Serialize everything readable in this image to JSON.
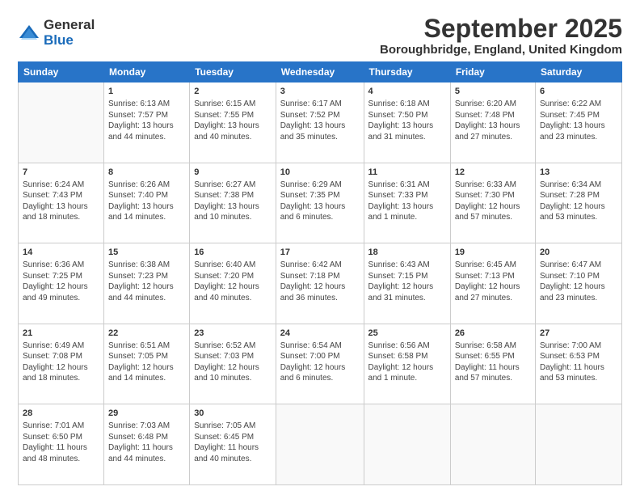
{
  "logo": {
    "general": "General",
    "blue": "Blue"
  },
  "title": "September 2025",
  "location": "Boroughbridge, England, United Kingdom",
  "weekdays": [
    "Sunday",
    "Monday",
    "Tuesday",
    "Wednesday",
    "Thursday",
    "Friday",
    "Saturday"
  ],
  "weeks": [
    [
      {
        "day": "",
        "content": ""
      },
      {
        "day": "1",
        "content": "Sunrise: 6:13 AM\nSunset: 7:57 PM\nDaylight: 13 hours and 44 minutes."
      },
      {
        "day": "2",
        "content": "Sunrise: 6:15 AM\nSunset: 7:55 PM\nDaylight: 13 hours and 40 minutes."
      },
      {
        "day": "3",
        "content": "Sunrise: 6:17 AM\nSunset: 7:52 PM\nDaylight: 13 hours and 35 minutes."
      },
      {
        "day": "4",
        "content": "Sunrise: 6:18 AM\nSunset: 7:50 PM\nDaylight: 13 hours and 31 minutes."
      },
      {
        "day": "5",
        "content": "Sunrise: 6:20 AM\nSunset: 7:48 PM\nDaylight: 13 hours and 27 minutes."
      },
      {
        "day": "6",
        "content": "Sunrise: 6:22 AM\nSunset: 7:45 PM\nDaylight: 13 hours and 23 minutes."
      }
    ],
    [
      {
        "day": "7",
        "content": "Sunrise: 6:24 AM\nSunset: 7:43 PM\nDaylight: 13 hours and 18 minutes."
      },
      {
        "day": "8",
        "content": "Sunrise: 6:26 AM\nSunset: 7:40 PM\nDaylight: 13 hours and 14 minutes."
      },
      {
        "day": "9",
        "content": "Sunrise: 6:27 AM\nSunset: 7:38 PM\nDaylight: 13 hours and 10 minutes."
      },
      {
        "day": "10",
        "content": "Sunrise: 6:29 AM\nSunset: 7:35 PM\nDaylight: 13 hours and 6 minutes."
      },
      {
        "day": "11",
        "content": "Sunrise: 6:31 AM\nSunset: 7:33 PM\nDaylight: 13 hours and 1 minute."
      },
      {
        "day": "12",
        "content": "Sunrise: 6:33 AM\nSunset: 7:30 PM\nDaylight: 12 hours and 57 minutes."
      },
      {
        "day": "13",
        "content": "Sunrise: 6:34 AM\nSunset: 7:28 PM\nDaylight: 12 hours and 53 minutes."
      }
    ],
    [
      {
        "day": "14",
        "content": "Sunrise: 6:36 AM\nSunset: 7:25 PM\nDaylight: 12 hours and 49 minutes."
      },
      {
        "day": "15",
        "content": "Sunrise: 6:38 AM\nSunset: 7:23 PM\nDaylight: 12 hours and 44 minutes."
      },
      {
        "day": "16",
        "content": "Sunrise: 6:40 AM\nSunset: 7:20 PM\nDaylight: 12 hours and 40 minutes."
      },
      {
        "day": "17",
        "content": "Sunrise: 6:42 AM\nSunset: 7:18 PM\nDaylight: 12 hours and 36 minutes."
      },
      {
        "day": "18",
        "content": "Sunrise: 6:43 AM\nSunset: 7:15 PM\nDaylight: 12 hours and 31 minutes."
      },
      {
        "day": "19",
        "content": "Sunrise: 6:45 AM\nSunset: 7:13 PM\nDaylight: 12 hours and 27 minutes."
      },
      {
        "day": "20",
        "content": "Sunrise: 6:47 AM\nSunset: 7:10 PM\nDaylight: 12 hours and 23 minutes."
      }
    ],
    [
      {
        "day": "21",
        "content": "Sunrise: 6:49 AM\nSunset: 7:08 PM\nDaylight: 12 hours and 18 minutes."
      },
      {
        "day": "22",
        "content": "Sunrise: 6:51 AM\nSunset: 7:05 PM\nDaylight: 12 hours and 14 minutes."
      },
      {
        "day": "23",
        "content": "Sunrise: 6:52 AM\nSunset: 7:03 PM\nDaylight: 12 hours and 10 minutes."
      },
      {
        "day": "24",
        "content": "Sunrise: 6:54 AM\nSunset: 7:00 PM\nDaylight: 12 hours and 6 minutes."
      },
      {
        "day": "25",
        "content": "Sunrise: 6:56 AM\nSunset: 6:58 PM\nDaylight: 12 hours and 1 minute."
      },
      {
        "day": "26",
        "content": "Sunrise: 6:58 AM\nSunset: 6:55 PM\nDaylight: 11 hours and 57 minutes."
      },
      {
        "day": "27",
        "content": "Sunrise: 7:00 AM\nSunset: 6:53 PM\nDaylight: 11 hours and 53 minutes."
      }
    ],
    [
      {
        "day": "28",
        "content": "Sunrise: 7:01 AM\nSunset: 6:50 PM\nDaylight: 11 hours and 48 minutes."
      },
      {
        "day": "29",
        "content": "Sunrise: 7:03 AM\nSunset: 6:48 PM\nDaylight: 11 hours and 44 minutes."
      },
      {
        "day": "30",
        "content": "Sunrise: 7:05 AM\nSunset: 6:45 PM\nDaylight: 11 hours and 40 minutes."
      },
      {
        "day": "",
        "content": ""
      },
      {
        "day": "",
        "content": ""
      },
      {
        "day": "",
        "content": ""
      },
      {
        "day": "",
        "content": ""
      }
    ]
  ]
}
